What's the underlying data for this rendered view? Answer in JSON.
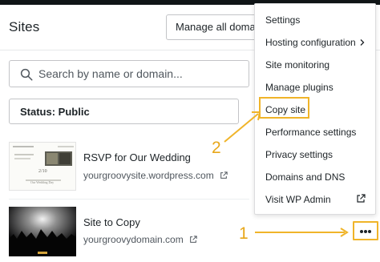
{
  "header": {
    "title": "Sites",
    "manage_domains_label": "Manage all domains"
  },
  "search": {
    "placeholder": "Search by name or domain..."
  },
  "filter": {
    "status_label": "Status: Public"
  },
  "sites": [
    {
      "title": "RSVP for Our Wedding",
      "url": "yourgroovysite.wordpress.com",
      "thumb_small_text": "Our Wedding Day",
      "thumb_date": "2/10"
    },
    {
      "title": "Site to Copy",
      "url": "yourgroovydomain.com"
    }
  ],
  "menu": {
    "items": [
      {
        "label": "Settings"
      },
      {
        "label": "Hosting configuration"
      },
      {
        "label": "Site monitoring"
      },
      {
        "label": "Manage plugins"
      },
      {
        "label": "Copy site"
      },
      {
        "label": "Performance settings"
      },
      {
        "label": "Privacy settings"
      },
      {
        "label": "Domains and DNS"
      },
      {
        "label": "Visit WP Admin"
      }
    ]
  },
  "annotations": {
    "step1": "1",
    "step2": "2"
  },
  "icons": {
    "search": "search-icon",
    "external": "external-link-icon",
    "chevron": "chevron-right-icon",
    "more": "more-horizontal-icon"
  },
  "colors": {
    "highlight": "#f0b429",
    "topbar": "#101517",
    "text": "#1d2327"
  }
}
